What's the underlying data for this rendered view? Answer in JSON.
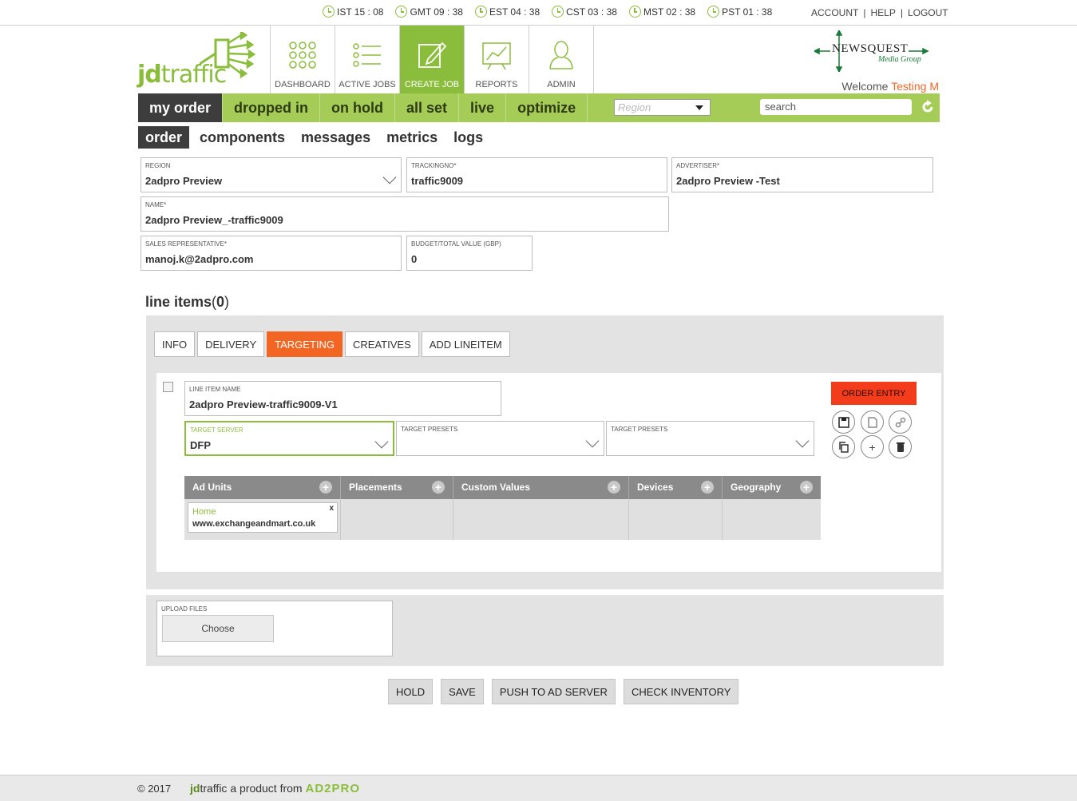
{
  "clocks": [
    {
      "label": "IST 15 : 08"
    },
    {
      "label": "GMT 09 : 38"
    },
    {
      "label": "EST 04 : 38"
    },
    {
      "label": "CST 03 : 38"
    },
    {
      "label": "MST 02 : 38"
    },
    {
      "label": "PST 01 : 38"
    }
  ],
  "toplinks": {
    "account": "ACCOUNT",
    "sep": "|",
    "help": "HELP",
    "logout": "LOGOUT"
  },
  "logo": {
    "prefix": "jd",
    "suffix": "traffic"
  },
  "nav": {
    "tabs": [
      {
        "label": "DASHBOARD",
        "icon": "dashboard-grid-icon"
      },
      {
        "label": "ACTIVE JOBS",
        "icon": "list-icon"
      },
      {
        "label": "CREATE JOB",
        "icon": "edit-icon"
      },
      {
        "label": "REPORTS",
        "icon": "chart-icon"
      },
      {
        "label": "ADMIN",
        "icon": "user-icon"
      }
    ],
    "active_index": 2
  },
  "brand": {
    "name": "NEWSQUEST",
    "sub": "Media Group"
  },
  "welcome": {
    "prefix": "Welcome",
    "user": "Testing M"
  },
  "statusbar": {
    "tabs": [
      "my order",
      "dropped in",
      "on hold",
      "all set",
      "live",
      "optimize"
    ],
    "region_placeholder": "Region",
    "search_value": "search"
  },
  "subtabs": [
    "order",
    "components",
    "messages",
    "metrics",
    "logs"
  ],
  "form": {
    "region": {
      "label": "REGION",
      "value": "2adpro Preview"
    },
    "trackingno": {
      "label": "TRACKINGNO*",
      "value": "traffic9009"
    },
    "advertiser": {
      "label": "ADVERTISER*",
      "value": "2adpro Preview -Test"
    },
    "name": {
      "label": "NAME*",
      "value": "2adpro Preview_-traffic9009"
    },
    "sales_rep": {
      "label": "SALES REPRESENTATIVE*",
      "value": "manoj.k@2adpro.com"
    },
    "budget": {
      "label": "BUDGET/TOTAL VALUE (GBP)",
      "value": "0"
    }
  },
  "line_items": {
    "title": "line items",
    "count_open": "(",
    "count": "0",
    "count_close": ")",
    "tabs": [
      "INFO",
      "DELIVERY",
      "TARGETING",
      "CREATIVES",
      "ADD LINEITEM"
    ],
    "active_tab": "TARGETING",
    "item": {
      "name_label": "LINE ITEM NAME",
      "name_value": "2adpro Preview-traffic9009-V1",
      "target_server_label": "TARGET SERVER",
      "target_server_value": "DFP",
      "preset1_label": "TARGET PRESETS",
      "preset2_label": "TARGET PRESETS",
      "order_entry": "ORDER ENTRY",
      "columns": [
        "Ad Units",
        "Placements",
        "Custom Values",
        "Devices",
        "Geography"
      ],
      "ad_unit_chip": {
        "title": "Home",
        "value": "www.exchangeandmart.co.uk",
        "close": "x"
      }
    }
  },
  "upload": {
    "label": "UPLOAD FILES",
    "button": "Choose"
  },
  "actions": [
    "HOLD",
    "SAVE",
    "PUSH TO AD SERVER",
    "CHECK INVENTORY"
  ],
  "footer": {
    "copyright": "© 2017",
    "jd": "jd",
    "traffic": "traffic",
    "product": "a product from",
    "company": "AD2PRO"
  },
  "colors": {
    "accent_green": "#8bbd3c",
    "orange": "#f26522",
    "order_entry_red": "#f23c1c",
    "dark": "#3d3d3d"
  }
}
